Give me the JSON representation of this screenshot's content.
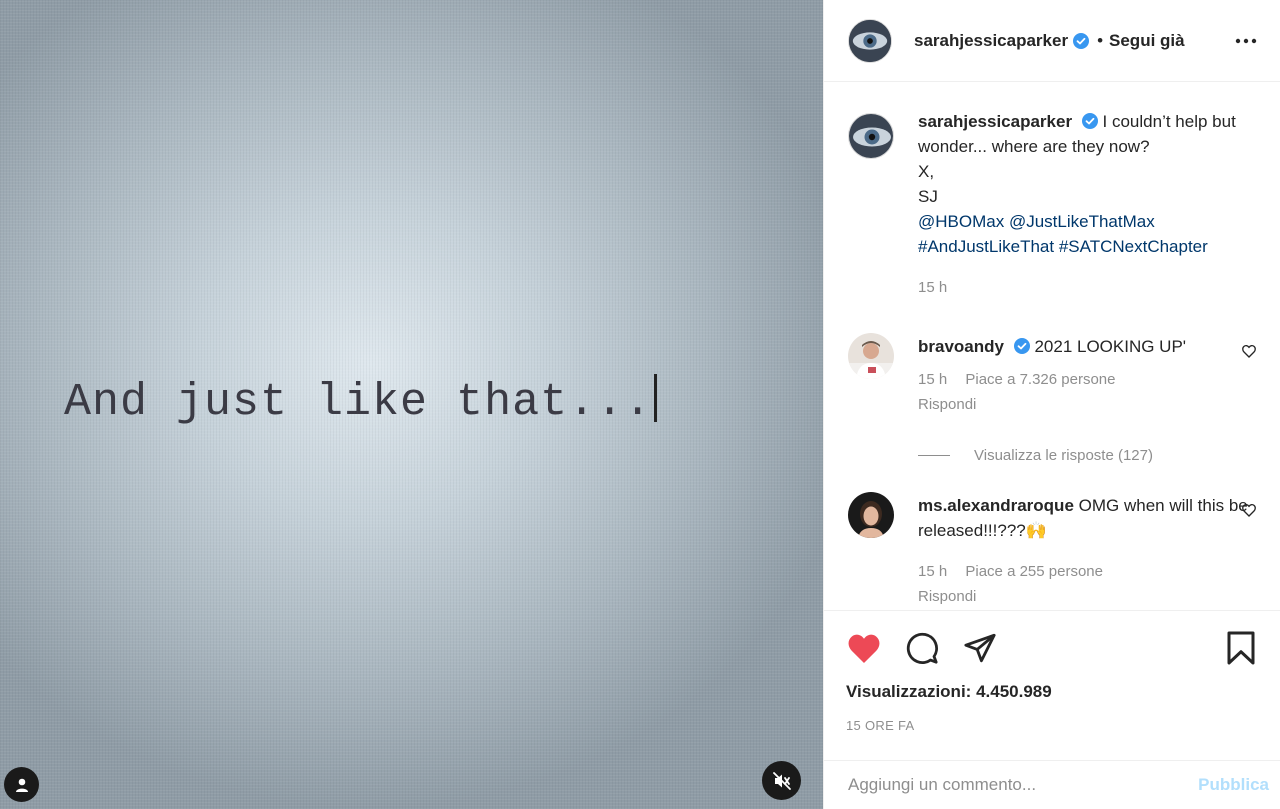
{
  "media": {
    "video_text": "And just like that..."
  },
  "header": {
    "username": "sarahjessicaparker",
    "separator": "•",
    "follow_label": "Segui già"
  },
  "caption": {
    "username": "sarahjessicaparker",
    "text": "I couldn’t help but wonder... where are they now?",
    "line2": "X,",
    "line3": "SJ",
    "mention1": "@HBOMax",
    "mention2": "@JustLikeThatMax",
    "hashtag1": "#AndJustLikeThat",
    "hashtag2": "#SATCNextChapter",
    "time": "15 h"
  },
  "comments": [
    {
      "username": "bravoandy",
      "text": "2021 LOOKING UP'",
      "time": "15 h",
      "likes": "Piace a 7.326 persone",
      "reply": "Rispondi",
      "view_replies": "Visualizza le risposte (127)"
    },
    {
      "username": "ms.alexandraroque",
      "text": "OMG when will this be released!!!???🙌",
      "time": "15 h",
      "likes": "Piace a 255 persone",
      "reply": "Rispondi"
    }
  ],
  "stats": {
    "views_label": "Visualizzazioni:",
    "views_value": "4.450.989",
    "time_ago": "15 ORE FA"
  },
  "add_comment": {
    "placeholder": "Aggiungi un commento...",
    "publish_label": "Pubblica"
  },
  "colors": {
    "like_red": "#ed4956",
    "verified_blue": "#3897f0",
    "link_blue": "#00376b",
    "publish_disabled": "#b2dffc"
  }
}
